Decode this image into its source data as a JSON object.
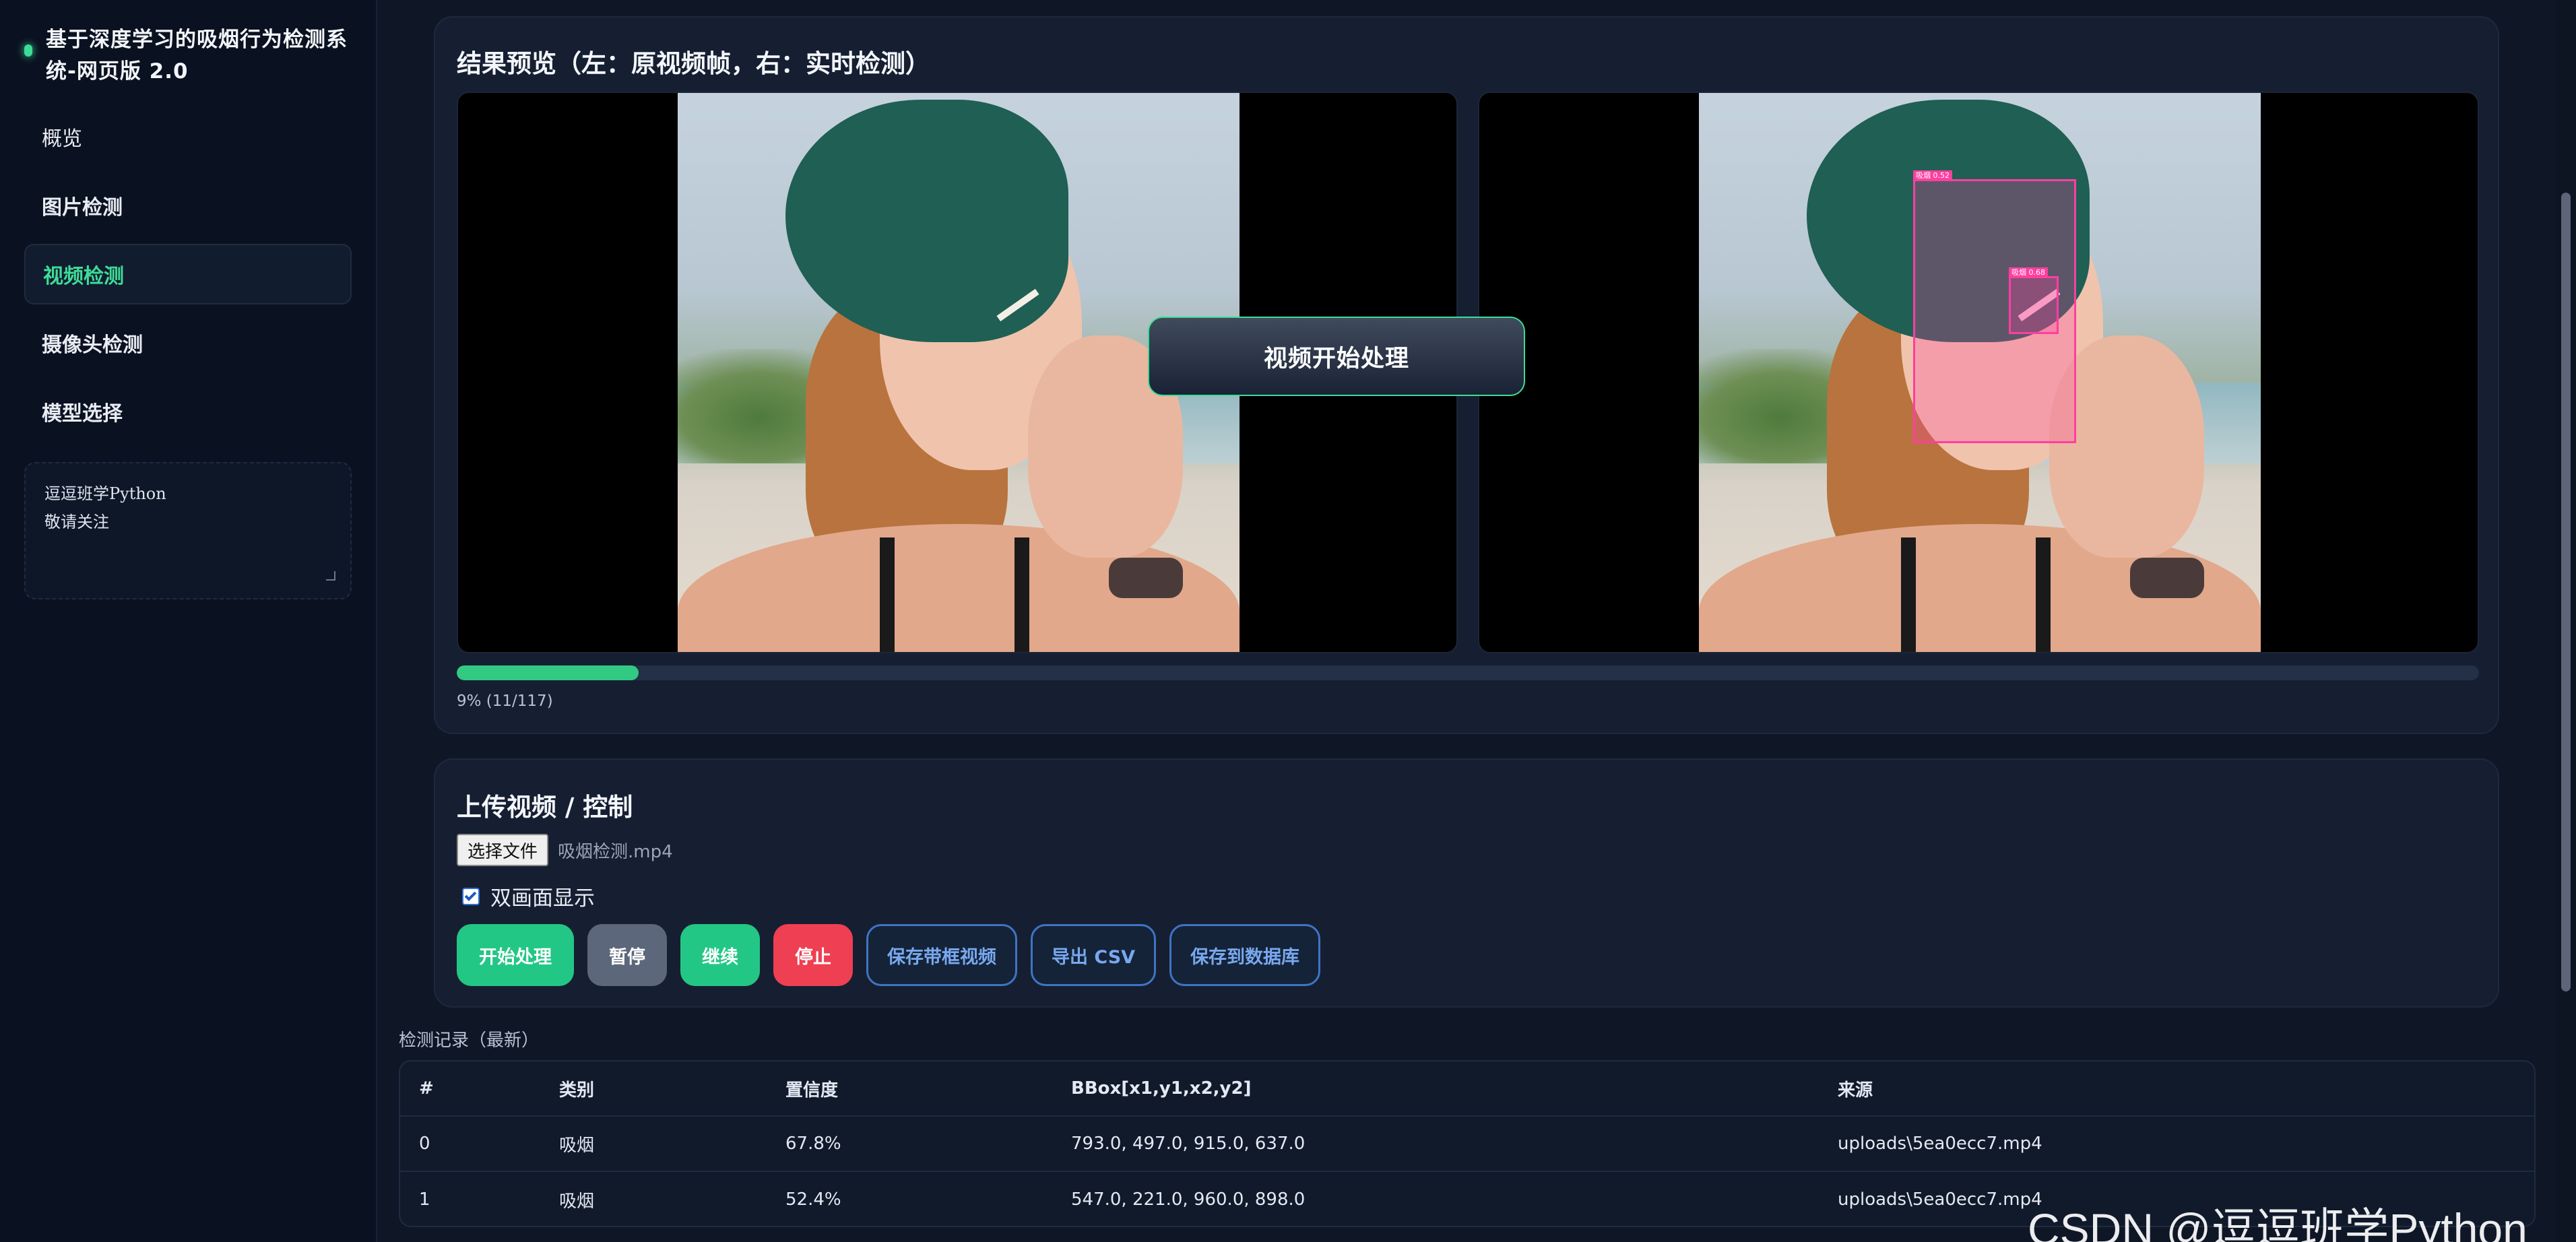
{
  "brand": {
    "title": "基于深度学习的吸烟行为检测系统-网页版 2.0"
  },
  "sidebar": {
    "items": [
      {
        "label": "概览"
      },
      {
        "label": "图片检测"
      },
      {
        "label": "视频检测"
      },
      {
        "label": "摄像头检测"
      },
      {
        "label": "模型选择"
      }
    ],
    "active": "视频检测",
    "note_lines": [
      "逗逗班学Python",
      "敬请关注"
    ]
  },
  "preview": {
    "title": "结果预览（左：原视频帧，右：实时检测）",
    "toast": "视频开始处理",
    "progress": {
      "fraction": 0.09,
      "text": "9% (11/117)"
    },
    "detections": [
      {
        "label": "吸烟 0.52"
      },
      {
        "label": "吸烟 0.68"
      }
    ],
    "accent_color": "#32c982",
    "box_color": "#ff3fa0"
  },
  "upload": {
    "title": "上传视频 / 控制",
    "file_button": "选择文件",
    "file_name": "吸烟检测.mp4",
    "dual_view_label": "双画面显示",
    "dual_view_checked": true,
    "buttons": {
      "start": "开始处理",
      "pause": "暂停",
      "resume": "继续",
      "stop": "停止",
      "save_video": "保存带框视频",
      "export_csv": "导出 CSV",
      "save_db": "保存到数据库"
    }
  },
  "records": {
    "title": "检测记录（最新）",
    "columns": [
      "#",
      "类别",
      "置信度",
      "BBox[x1,y1,x2,y2]",
      "来源"
    ],
    "rows": [
      [
        "0",
        "吸烟",
        "67.8%",
        "793.0, 497.0, 915.0, 637.0",
        "uploads\\5ea0ecc7.mp4"
      ],
      [
        "1",
        "吸烟",
        "52.4%",
        "547.0, 221.0, 960.0, 898.0",
        "uploads\\5ea0ecc7.mp4"
      ]
    ]
  },
  "watermark": "CSDN @逗逗班学Python"
}
